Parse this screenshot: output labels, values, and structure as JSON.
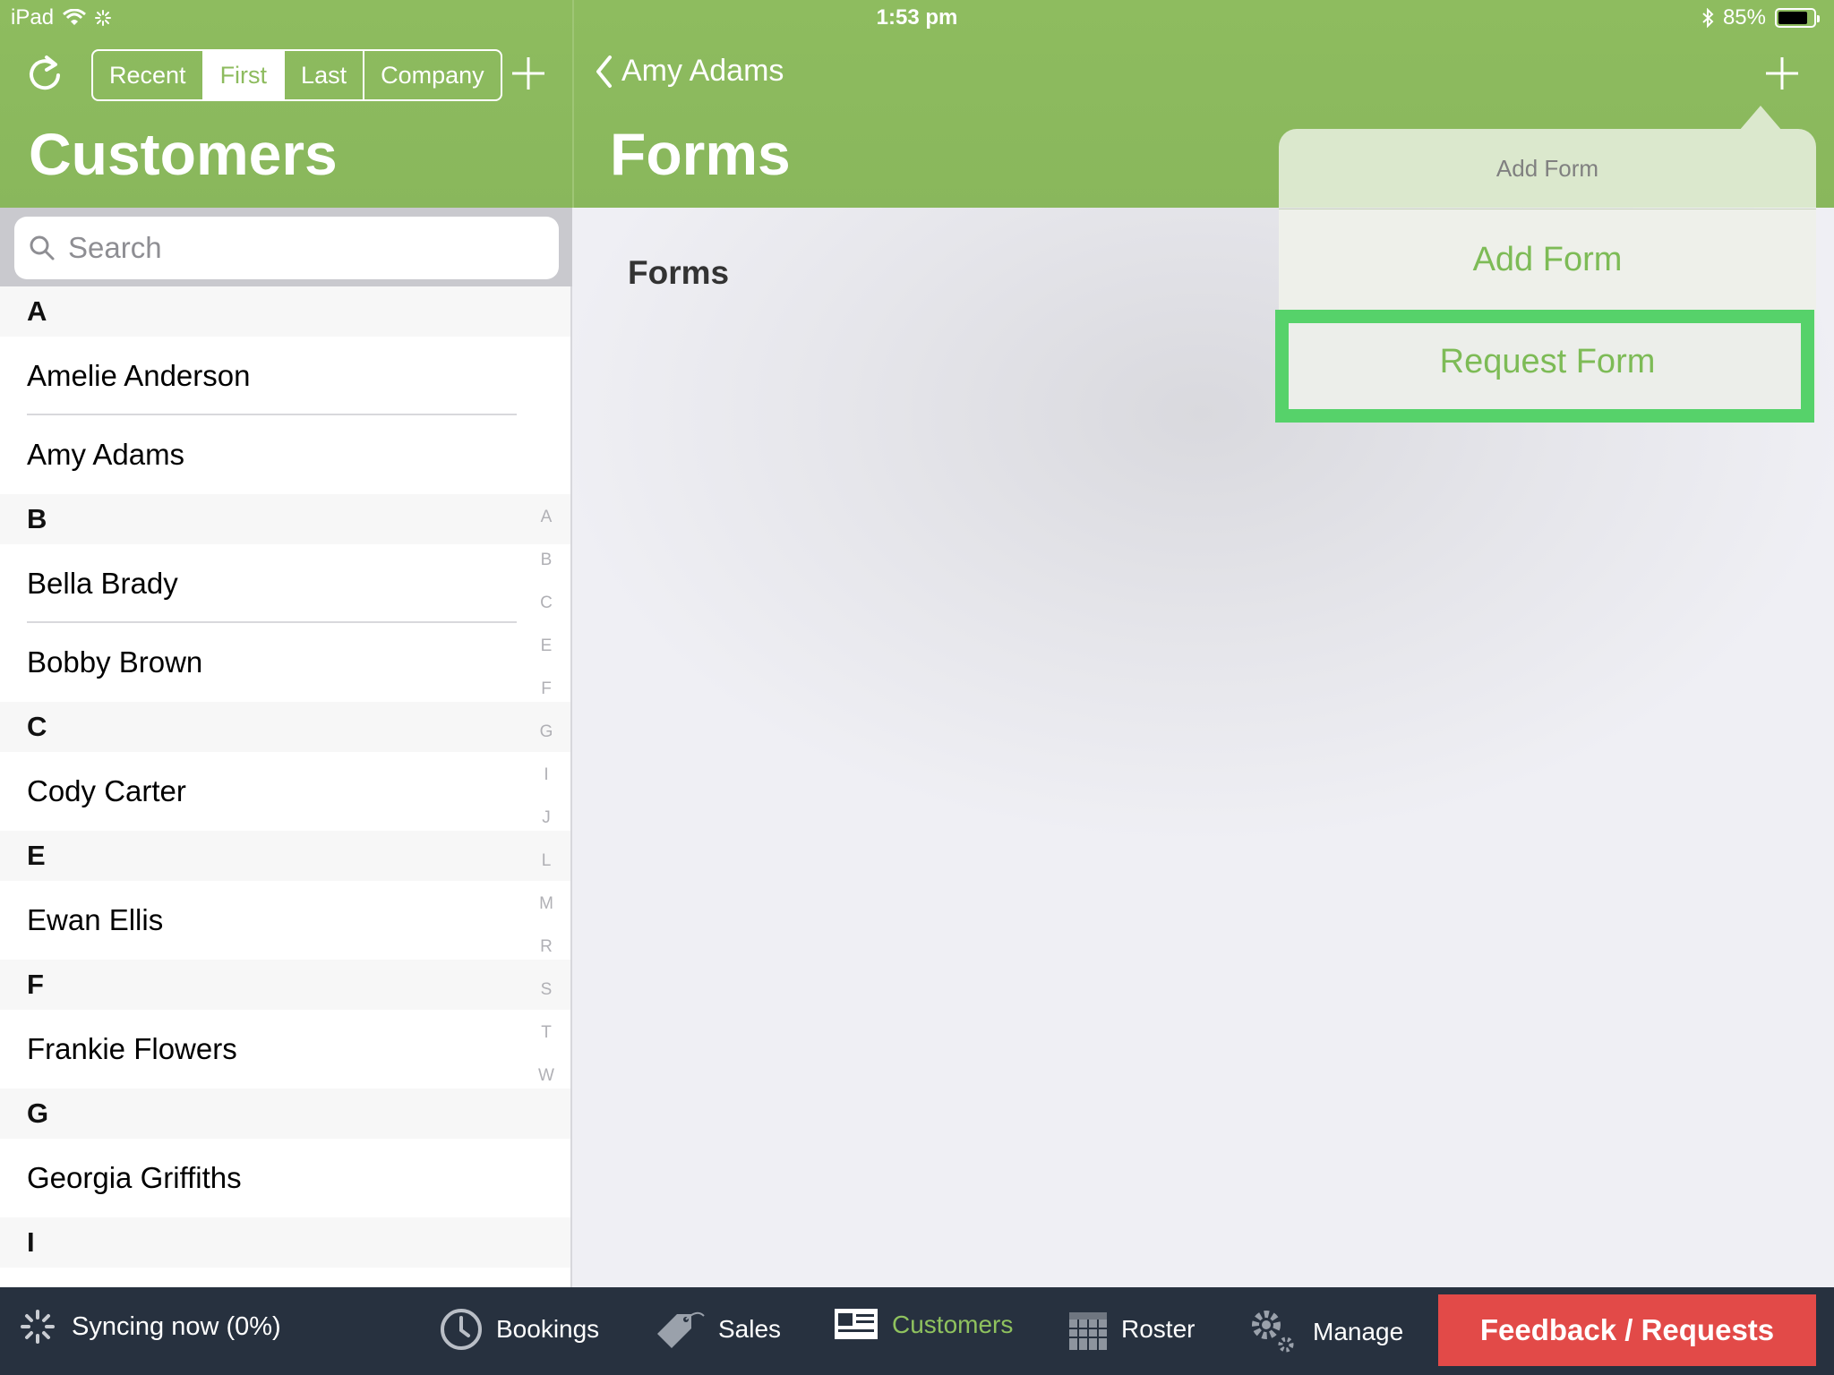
{
  "status_bar": {
    "device": "iPad",
    "time": "1:53 pm",
    "battery": "85%",
    "battery_level": 0.85
  },
  "left_header": {
    "segments": [
      "Recent",
      "First",
      "Last",
      "Company"
    ],
    "active_segment": "First",
    "title": "Customers"
  },
  "search": {
    "placeholder": "Search"
  },
  "customer_list": {
    "sections": [
      {
        "letter": "A",
        "rows": [
          "Amelie Anderson",
          "Amy Adams"
        ]
      },
      {
        "letter": "B",
        "rows": [
          "Bella Brady",
          "Bobby Brown"
        ]
      },
      {
        "letter": "C",
        "rows": [
          "Cody  Carter"
        ]
      },
      {
        "letter": "E",
        "rows": [
          "Ewan Ellis"
        ]
      },
      {
        "letter": "F",
        "rows": [
          "Frankie Flowers"
        ]
      },
      {
        "letter": "G",
        "rows": [
          "Georgia Griffiths"
        ]
      },
      {
        "letter": "I",
        "rows": []
      }
    ],
    "index_letters": [
      "A",
      "B",
      "C",
      "E",
      "F",
      "G",
      "I",
      "J",
      "L",
      "M",
      "R",
      "S",
      "T",
      "W"
    ]
  },
  "detail": {
    "back_label": "Amy Adams",
    "title": "Forms",
    "section_label": "Forms"
  },
  "popover": {
    "title": "Add Form",
    "items": [
      "Add Form",
      "Request Form"
    ],
    "highlighted_item": "Request Form"
  },
  "toolbar": {
    "sync_status": "Syncing now (0%)",
    "tabs": [
      "Bookings",
      "Sales",
      "Customers",
      "Roster",
      "Manage"
    ],
    "active_tab": "Customers",
    "feedback_label": "Feedback / Requests"
  },
  "colors": {
    "header_green": "#8ebc5f",
    "accent_green": "#7dbb56",
    "highlight_green": "#56d26a",
    "toolbar_bg": "#27313f",
    "feedback_red": "#e24a48"
  },
  "icons": [
    "wifi-icon",
    "activity-icon",
    "bluetooth-icon",
    "battery-icon",
    "refresh-icon",
    "plus-icon",
    "back-chevron-icon",
    "search-icon",
    "sync-spinner-icon",
    "clock-icon",
    "price-tag-icon",
    "customers-card-icon",
    "calendar-icon",
    "gear-icon"
  ]
}
